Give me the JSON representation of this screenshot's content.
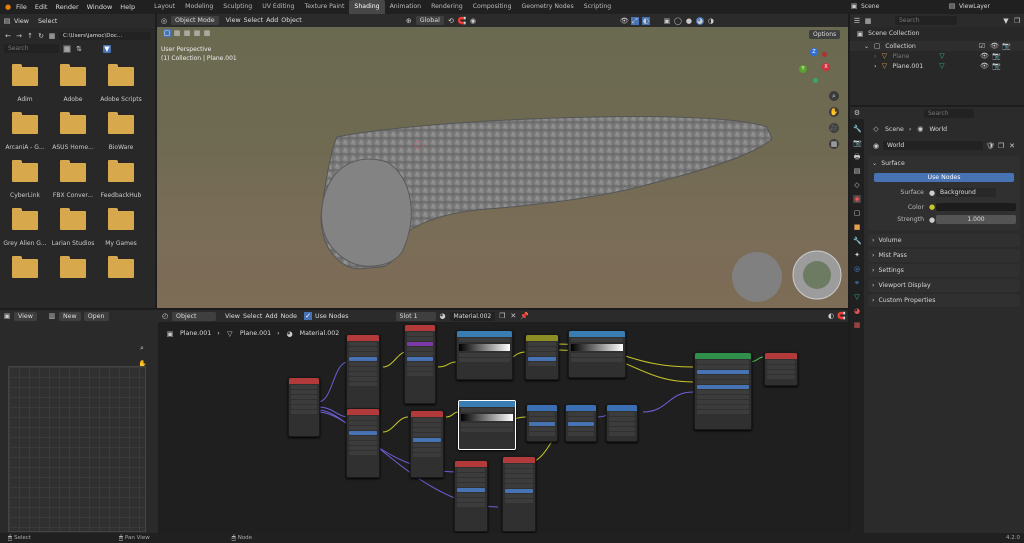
{
  "topbar": {
    "menu": [
      "File",
      "Edit",
      "Render",
      "Window",
      "Help"
    ],
    "workspaces": [
      "Layout",
      "Modeling",
      "Sculpting",
      "UV Editing",
      "Texture Paint",
      "Shading",
      "Animation",
      "Rendering",
      "Compositing",
      "Geometry Nodes",
      "Scripting"
    ],
    "active_workspace": "Shading",
    "scene": "Scene",
    "view_layer": "ViewLayer"
  },
  "filebrowser": {
    "menu": [
      "View",
      "Select"
    ],
    "path": "C:\\Users\\jamoc\\Doc...",
    "search_placeholder": "Search",
    "folders": [
      "Adim",
      "Adobe",
      "Adobe Scripts",
      "ArcaniA - G...",
      "ASUS Home...",
      "BioWare",
      "CyberLink",
      "FBX Conver...",
      "FeedbackHub",
      "Grey Alien G...",
      "Larian Studios",
      "My Games",
      "",
      "",
      ""
    ]
  },
  "imageeditor": {
    "view": "View",
    "new": "New",
    "open": "Open"
  },
  "viewport": {
    "mode": "Object Mode",
    "menu": [
      "View",
      "Select",
      "Add",
      "Object"
    ],
    "orientation": "Global",
    "options": "Options",
    "overlay_line1": "User Perspective",
    "overlay_line2": "(1) Collection | Plane.001",
    "axes": {
      "z": "Z",
      "y": "Y",
      "x": "X"
    }
  },
  "shader": {
    "type": "Object",
    "menu": [
      "View",
      "Select",
      "Add",
      "Node"
    ],
    "use_nodes": "Use Nodes",
    "slot": "Slot 1",
    "material": "Material.002",
    "breadcrumb": [
      "Plane.001",
      "Plane.001",
      "Material.002"
    ]
  },
  "outliner": {
    "search_placeholder": "Search",
    "title": "Scene Collection",
    "items": [
      "Collection",
      "Plane",
      "Plane.001"
    ]
  },
  "properties": {
    "search_placeholder": "Search",
    "breadcrumb": [
      "Scene",
      "World"
    ],
    "world_name": "World",
    "surface_section": "Surface",
    "use_nodes": "Use Nodes",
    "rows": [
      {
        "label": "Surface",
        "value": "Background"
      },
      {
        "label": "Color",
        "value": ""
      },
      {
        "label": "Strength",
        "value": "1.000"
      }
    ],
    "sections": [
      "Volume",
      "Mist Pass",
      "Settings",
      "Viewport Display",
      "Custom Properties"
    ]
  },
  "status": {
    "left": "Select",
    "mid": "Pan View",
    "right": "Node",
    "version": "4.2.0"
  },
  "colors": {
    "accent": "#4772b3",
    "folder": "#d7a84c",
    "bg": "#1d1d1d"
  }
}
